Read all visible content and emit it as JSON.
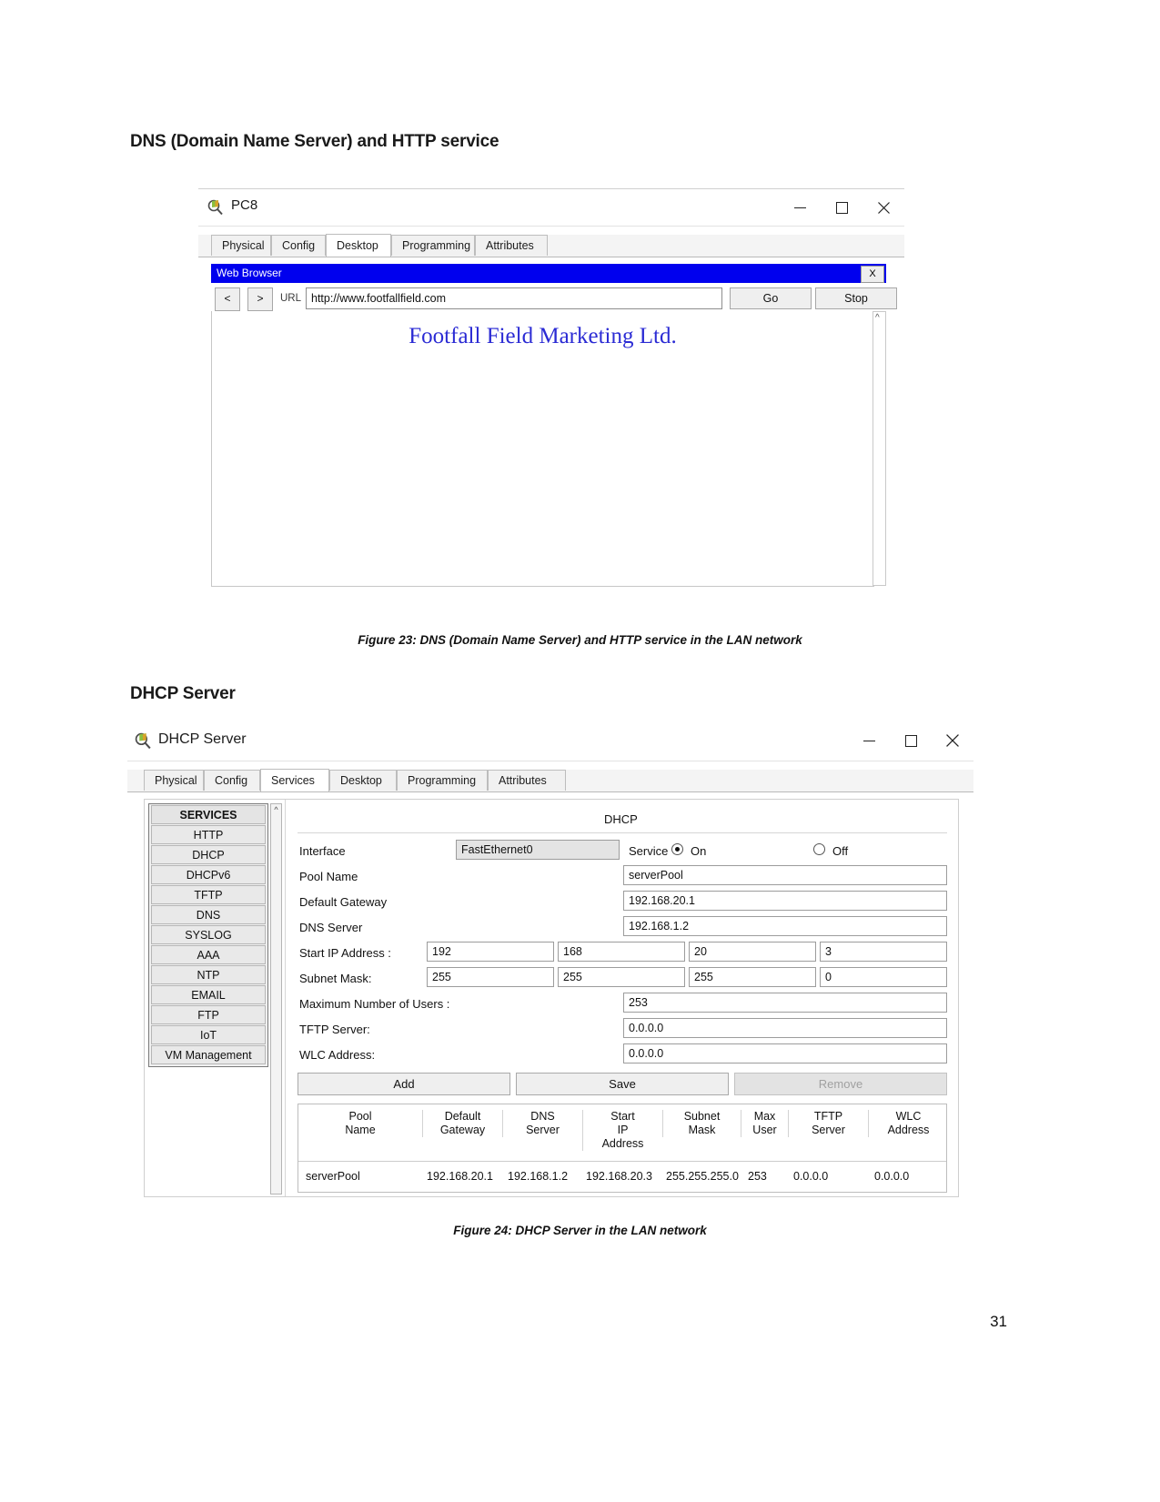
{
  "document": {
    "heading_1": "DNS (Domain Name Server) and HTTP service",
    "heading_2": "DHCP Server",
    "figure_23_caption": "Figure 23: DNS (Domain Name Server) and HTTP service in the LAN network",
    "figure_24_caption": "Figure 24: DHCP Server in the LAN network",
    "page_number": "31"
  },
  "pc_window": {
    "title": "PC8",
    "icon": "packet-tracer-icon",
    "window_controls": {
      "minimize": "minimize-icon",
      "maximize": "maximize-icon",
      "close": "close-icon"
    },
    "tabs": [
      {
        "label": "Physical",
        "active": false
      },
      {
        "label": "Config",
        "active": false
      },
      {
        "label": "Desktop",
        "active": true
      },
      {
        "label": "Programming",
        "active": false
      },
      {
        "label": "Attributes",
        "active": false
      }
    ],
    "browser": {
      "title": "Web Browser",
      "close_label": "X",
      "back_label": "<",
      "forward_label": ">",
      "url_label": "URL",
      "url_value": "http://www.footfallfield.com",
      "url_placeholder": "http://",
      "go_label": "Go",
      "stop_label": "Stop",
      "page_title": "Footfall Field Marketing Ltd.",
      "page_title_color": "#2b2bd4",
      "scroll_up_icon": "chevron-up-icon"
    }
  },
  "dhcp_window": {
    "title": "DHCP Server",
    "icon": "packet-tracer-icon",
    "window_controls": {
      "minimize": "minimize-icon",
      "maximize": "maximize-icon",
      "close": "close-icon"
    },
    "tabs": [
      {
        "label": "Physical",
        "active": false
      },
      {
        "label": "Config",
        "active": false
      },
      {
        "label": "Services",
        "active": true
      },
      {
        "label": "Desktop",
        "active": false
      },
      {
        "label": "Programming",
        "active": false
      },
      {
        "label": "Attributes",
        "active": false
      }
    ],
    "services_sidebar": {
      "header": "SERVICES",
      "items": [
        "HTTP",
        "DHCP",
        "DHCPv6",
        "TFTP",
        "DNS",
        "SYSLOG",
        "AAA",
        "NTP",
        "EMAIL",
        "FTP",
        "IoT",
        "VM Management"
      ]
    },
    "panel": {
      "heading": "DHCP",
      "interface_label": "Interface",
      "interface_value": "FastEthernet0",
      "service_label": "Service",
      "service_on_label": "On",
      "service_off_label": "Off",
      "service_state": "On",
      "pool_name_label": "Pool Name",
      "pool_name_value": "serverPool",
      "default_gateway_label": "Default Gateway",
      "default_gateway_value": "192.168.20.1",
      "dns_server_label": "DNS Server",
      "dns_server_value": "192.168.1.2",
      "start_ip_label": "Start IP Address :",
      "start_ip_octets": [
        "192",
        "168",
        "20",
        "3"
      ],
      "subnet_mask_label": "Subnet Mask:",
      "subnet_mask_octets": [
        "255",
        "255",
        "255",
        "0"
      ],
      "max_users_label": "Maximum Number of Users :",
      "max_users_value": "253",
      "tftp_server_label": "TFTP Server:",
      "tftp_server_value": "0.0.0.0",
      "wlc_address_label": "WLC Address:",
      "wlc_address_value": "0.0.0.0",
      "add_label": "Add",
      "save_label": "Save",
      "remove_label": "Remove"
    },
    "pool_table": {
      "columns": [
        "Pool\nName",
        "Default\nGateway",
        "DNS\nServer",
        "Start\nIP\nAddress",
        "Subnet\nMask",
        "Max\nUser",
        "TFTP\nServer",
        "WLC\nAddress"
      ],
      "rows": [
        {
          "pool_name": "serverPool",
          "default_gateway": "192.168.20.1",
          "dns_server": "192.168.1.2",
          "start_ip_address": "192.168.20.3",
          "subnet_mask": "255.255.255.0",
          "max_user": "253",
          "tftp_server": "0.0.0.0",
          "wlc_address": "0.0.0.0"
        }
      ]
    }
  }
}
